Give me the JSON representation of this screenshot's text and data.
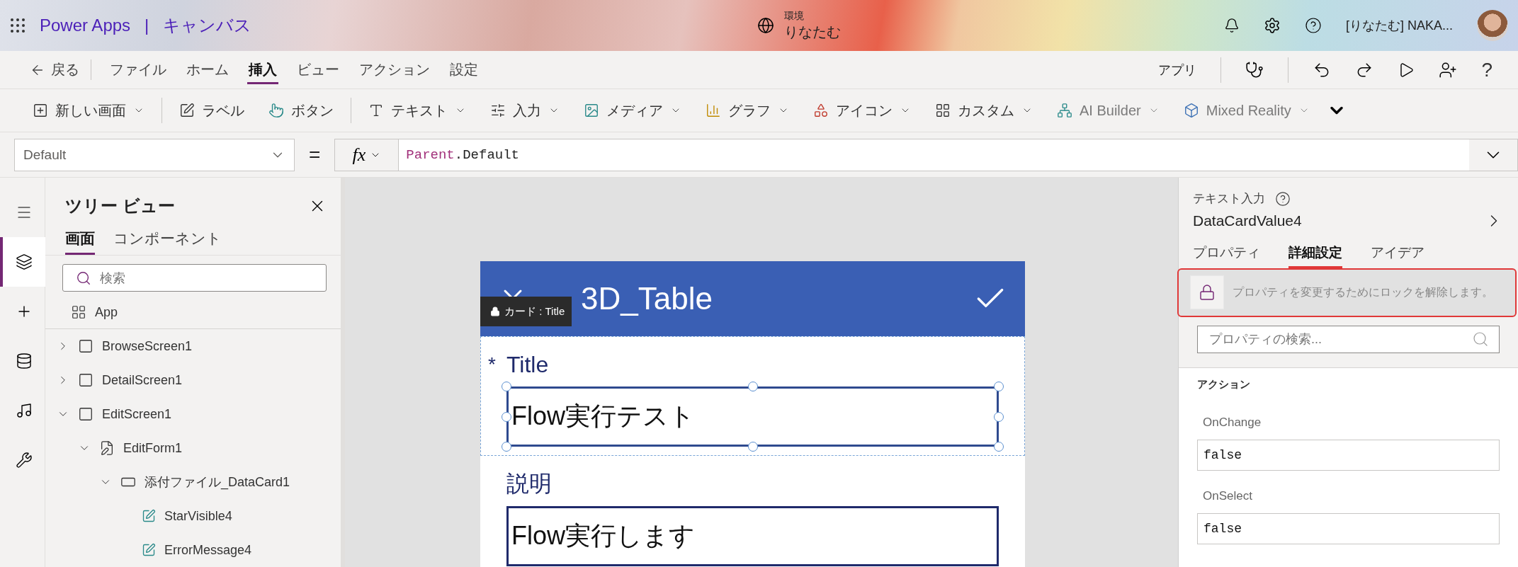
{
  "header": {
    "app_name": "Power Apps",
    "separator": "|",
    "app_type": "キャンバス",
    "environment": {
      "label": "環境",
      "value": "りなたむ"
    },
    "user_name": "[りなたむ] NAKA..."
  },
  "menu": {
    "back": "戻る",
    "tabs": [
      {
        "label": "ファイル",
        "selected": false
      },
      {
        "label": "ホーム",
        "selected": false
      },
      {
        "label": "挿入",
        "selected": true
      },
      {
        "label": "ビュー",
        "selected": false
      },
      {
        "label": "アクション",
        "selected": false
      },
      {
        "label": "設定",
        "selected": false
      }
    ],
    "app_label": "アプリ",
    "help": "?"
  },
  "ribbon": {
    "groups": [
      [
        {
          "label": "新しい画面",
          "dropdown": true,
          "disabled": false
        }
      ],
      [
        {
          "label": "ラベル",
          "dropdown": false,
          "disabled": false
        },
        {
          "label": "ボタン",
          "dropdown": false,
          "disabled": false
        }
      ],
      [
        {
          "label": "テキスト",
          "dropdown": true,
          "disabled": false
        },
        {
          "label": "入力",
          "dropdown": true,
          "disabled": false
        },
        {
          "label": "メディア",
          "dropdown": true,
          "disabled": false
        },
        {
          "label": "グラフ",
          "dropdown": true,
          "disabled": false
        },
        {
          "label": "アイコン",
          "dropdown": true,
          "disabled": false
        },
        {
          "label": "カスタム",
          "dropdown": true,
          "disabled": false
        },
        {
          "label": "AI Builder",
          "dropdown": true,
          "disabled": true
        },
        {
          "label": "Mixed Reality",
          "dropdown": true,
          "disabled": true
        }
      ]
    ]
  },
  "formula_bar": {
    "property": "Default",
    "equals": "=",
    "fx": "fx",
    "formula": {
      "object": "Parent",
      "member": ".Default"
    }
  },
  "rail_items": [
    {
      "selected": true
    },
    {
      "selected": false
    },
    {
      "selected": false
    },
    {
      "selected": false
    },
    {
      "selected": false
    }
  ],
  "tree_view": {
    "title": "ツリー ビュー",
    "tabs": [
      {
        "label": "画面",
        "selected": true
      },
      {
        "label": "コンポーネント",
        "selected": false
      }
    ],
    "search_placeholder": "検索",
    "app_item": "App",
    "items": [
      {
        "label": "BrowseScreen1",
        "kind": "screen",
        "expanded": false
      },
      {
        "label": "DetailScreen1",
        "kind": "screen",
        "expanded": false
      },
      {
        "label": "EditScreen1",
        "kind": "screen",
        "expanded": true,
        "children": [
          {
            "label": "EditForm1",
            "kind": "form",
            "expanded": true,
            "children": [
              {
                "label": "添付ファイル_DataCard1",
                "kind": "card",
                "expanded": true,
                "children": [
                  {
                    "label": "StarVisible4",
                    "kind": "control"
                  },
                  {
                    "label": "ErrorMessage4",
                    "kind": "control"
                  }
                ]
              }
            ]
          }
        ]
      }
    ]
  },
  "canvas": {
    "form_title": "3D_Table",
    "tooltip": "カード : Title",
    "cards": [
      {
        "required_mark": "*",
        "label": "Title",
        "value": "Flow実行テスト",
        "selected": true
      },
      {
        "label": "説明",
        "value": "Flow実行します",
        "selected": false
      }
    ]
  },
  "properties_panel": {
    "control_type": "テキスト入力",
    "control_name": "DataCardValue4",
    "tabs": [
      {
        "label": "プロパティ",
        "selected": false
      },
      {
        "label": "詳細設定",
        "selected": true
      },
      {
        "label": "アイデア",
        "selected": false
      }
    ],
    "lock_message": "プロパティを変更するためにロックを解除します。",
    "search_placeholder": "プロパティの検索...",
    "section": "アクション",
    "properties": [
      {
        "name": "OnChange",
        "value": "false"
      },
      {
        "name": "OnSelect",
        "value": "false"
      }
    ]
  }
}
